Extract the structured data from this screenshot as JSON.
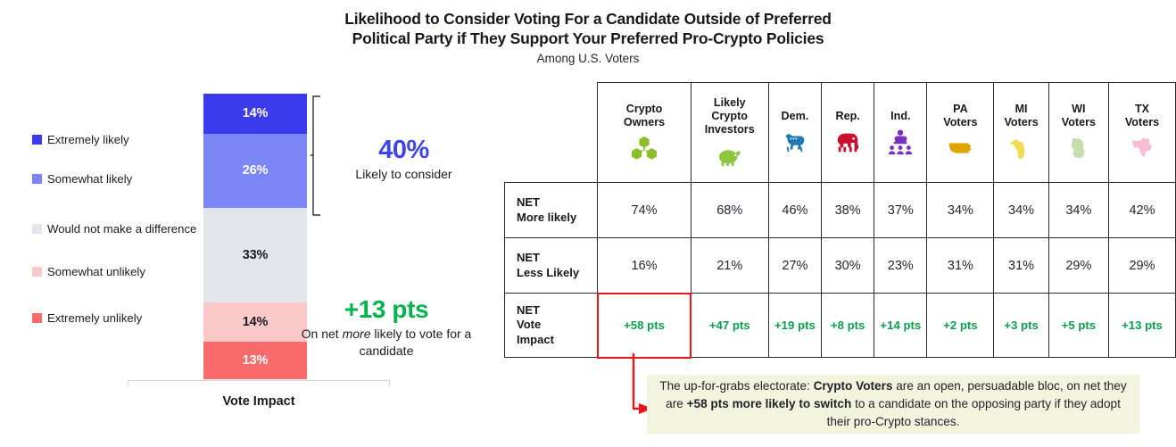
{
  "title": {
    "line1": "Likelihood to Consider Voting For a Candidate Outside of Preferred",
    "line2": "Political Party if They Support Your Preferred Pro-Crypto Policies",
    "subtitle": "Among U.S. Voters"
  },
  "legend": {
    "items": [
      {
        "label": "Extremely likely",
        "color": "#3B3BEE"
      },
      {
        "label": "Somewhat likely",
        "color": "#7B85F5"
      },
      {
        "label": "Would not make a difference",
        "color": "#E2E5EA"
      },
      {
        "label": "Somewhat unlikely",
        "color": "#FCC9C9"
      },
      {
        "label": "Extremely unlikely",
        "color": "#FA6A6A"
      }
    ]
  },
  "bar": {
    "axis_label": "Vote Impact",
    "segments": [
      {
        "label": "Extremely likely",
        "value": "14%",
        "pct": 14,
        "color": "#3B3BEE",
        "text": "light"
      },
      {
        "label": "Somewhat likely",
        "value": "26%",
        "pct": 26,
        "color": "#7B85F5",
        "text": "light"
      },
      {
        "label": "Would not make a difference",
        "value": "33%",
        "pct": 33,
        "color": "#E2E5EA",
        "text": "dark"
      },
      {
        "label": "Somewhat unlikely",
        "value": "14%",
        "pct": 14,
        "color": "#FCC9C9",
        "text": "dark"
      },
      {
        "label": "Extremely unlikely",
        "value": "13%",
        "pct": 13,
        "color": "#FA6A6A",
        "text": "light"
      }
    ]
  },
  "callouts": {
    "likely": {
      "value": "40%",
      "caption": "Likely to consider",
      "color": "#3F46E8"
    },
    "net": {
      "value": "+13 pts",
      "caption_pre": "On net ",
      "caption_em": "more",
      "caption_post": " likely to vote for a candidate",
      "color": "#07B24E"
    }
  },
  "table": {
    "corner": "",
    "columns": [
      {
        "label": "Crypto\nOwners",
        "name": "crypto-owners",
        "icon": "blockchain-cubes-icon",
        "icon_color": "#8CBE2B"
      },
      {
        "label": "Likely\nCrypto\nInvestors",
        "name": "likely-crypto-investors",
        "icon": "piggy-bank-icon",
        "icon_color": "#8CC63F"
      },
      {
        "label": "Dem.",
        "name": "democrats",
        "icon": "donkey-icon",
        "icon_color": "#1F77B4"
      },
      {
        "label": "Rep.",
        "name": "republicans",
        "icon": "elephant-icon",
        "icon_color": "#C8102E"
      },
      {
        "label": "Ind.",
        "name": "independents",
        "icon": "podium-speaker-icon",
        "icon_color": "#7B2FBE"
      },
      {
        "label": "PA\nVoters",
        "name": "pa-voters",
        "icon": "pennsylvania-map-icon",
        "icon_color": "#E0A400"
      },
      {
        "label": "MI\nVoters",
        "name": "mi-voters",
        "icon": "michigan-map-icon",
        "icon_color": "#F0DC50"
      },
      {
        "label": "WI\nVoters",
        "name": "wi-voters",
        "icon": "wisconsin-map-icon",
        "icon_color": "#C4DCAE"
      },
      {
        "label": "TX\nVoters",
        "name": "tx-voters",
        "icon": "texas-map-icon",
        "icon_color": "#F9BCD6"
      }
    ],
    "rows": [
      {
        "label": "NET\nMore likely",
        "name": "net-more-likely",
        "values": [
          "74%",
          "68%",
          "46%",
          "38%",
          "37%",
          "34%",
          "34%",
          "34%",
          "42%"
        ],
        "style": "value"
      },
      {
        "label": "NET\nLess Likely",
        "name": "net-less-likely",
        "values": [
          "16%",
          "21%",
          "27%",
          "30%",
          "23%",
          "31%",
          "31%",
          "29%",
          "29%"
        ],
        "style": "value"
      },
      {
        "label": "NET\nVote\nImpact",
        "name": "net-vote-impact",
        "values": [
          "+58 pts",
          "+47 pts",
          "+19 pts",
          "+8 pts",
          "+14 pts",
          "+2 pts",
          "+3 pts",
          "+5 pts",
          "+13 pts"
        ],
        "style": "points",
        "highlight_index": 0
      }
    ]
  },
  "note": {
    "p1": "The up-for-grabs electorate: ",
    "b1": "Crypto Voters",
    "p2": " are an open, persuadable bloc, on net they are ",
    "b2": "+58 pts more likely to switch",
    "p3": " to a candidate on the opposing party if they adopt their pro-Crypto stances."
  },
  "chart_data": {
    "type": "bar",
    "title": "Likelihood to Consider Voting For a Candidate Outside of Preferred Political Party if They Support Your Preferred Pro-Crypto Policies",
    "subtitle": "Among U.S. Voters",
    "xlabel": "Vote Impact",
    "ylabel": "",
    "ylim": [
      0,
      100
    ],
    "grid": false,
    "legend_position": "left",
    "categories": [
      "Vote Impact"
    ],
    "series": [
      {
        "name": "Extremely likely",
        "values": [
          14
        ],
        "color": "#3B3BEE"
      },
      {
        "name": "Somewhat likely",
        "values": [
          26
        ],
        "color": "#7B85F5"
      },
      {
        "name": "Would not make a difference",
        "values": [
          33
        ],
        "color": "#E2E5EA"
      },
      {
        "name": "Somewhat unlikely",
        "values": [
          14
        ],
        "color": "#FCC9C9"
      },
      {
        "name": "Extremely unlikely",
        "values": [
          13
        ],
        "color": "#FA6A6A"
      }
    ],
    "annotations": [
      {
        "text": "40%",
        "caption": "Likely to consider",
        "covers": [
          "Extremely likely",
          "Somewhat likely"
        ]
      },
      {
        "text": "+13 pts",
        "caption": "On net more likely to vote for a candidate"
      }
    ],
    "table": {
      "columns": [
        "Crypto Owners",
        "Likely Crypto Investors",
        "Dem.",
        "Rep.",
        "Ind.",
        "PA Voters",
        "MI Voters",
        "WI Voters",
        "TX Voters"
      ],
      "rows": [
        {
          "label": "NET More likely",
          "values": [
            "74%",
            "68%",
            "46%",
            "38%",
            "37%",
            "34%",
            "34%",
            "34%",
            "42%"
          ]
        },
        {
          "label": "NET Less Likely",
          "values": [
            "16%",
            "21%",
            "27%",
            "30%",
            "23%",
            "31%",
            "31%",
            "29%",
            "29%"
          ]
        },
        {
          "label": "NET Vote Impact",
          "values": [
            "+58 pts",
            "+47 pts",
            "+19 pts",
            "+8 pts",
            "+14 pts",
            "+2 pts",
            "+3 pts",
            "+5 pts",
            "+13 pts"
          ]
        }
      ]
    }
  }
}
